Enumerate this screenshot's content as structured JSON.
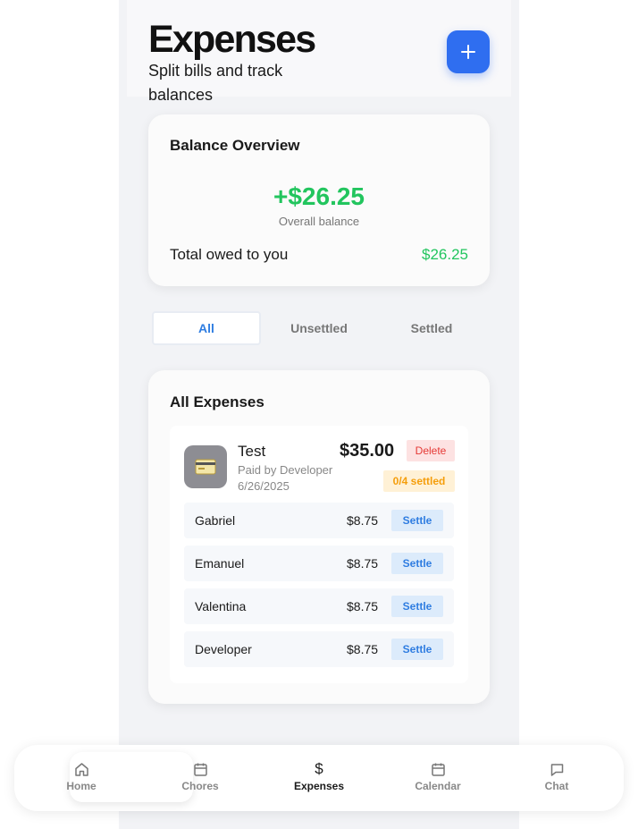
{
  "header": {
    "title": "Expenses",
    "subtitle": "Split bills and track balances"
  },
  "balance": {
    "title": "Balance Overview",
    "amount": "+$26.25",
    "caption": "Overall balance",
    "owed_label": "Total owed to you",
    "owed_value": "$26.25"
  },
  "filter_tabs": [
    {
      "label": "All",
      "active": true
    },
    {
      "label": "Unsettled",
      "active": false
    },
    {
      "label": "Settled",
      "active": false
    }
  ],
  "expenses_section": {
    "title": "All Expenses",
    "items": [
      {
        "name": "Test",
        "paid_by": "Paid by Developer",
        "date": "6/26/2025",
        "amount": "$35.00",
        "delete_label": "Delete",
        "settled_status": "0/4 settled",
        "icon": "credit-card-icon",
        "splits": [
          {
            "name": "Gabriel",
            "amount": "$8.75",
            "action": "Settle"
          },
          {
            "name": "Emanuel",
            "amount": "$8.75",
            "action": "Settle"
          },
          {
            "name": "Valentina",
            "amount": "$8.75",
            "action": "Settle"
          },
          {
            "name": "Developer",
            "amount": "$8.75",
            "action": "Settle"
          }
        ]
      }
    ]
  },
  "bottom_nav": [
    {
      "label": "Home",
      "icon": "home-icon"
    },
    {
      "label": "Chores",
      "icon": "calendar-icon"
    },
    {
      "label": "Expenses",
      "icon": "dollar-icon",
      "active": true
    },
    {
      "label": "Calendar",
      "icon": "calendar-icon"
    },
    {
      "label": "Chat",
      "icon": "chat-bubble-icon"
    }
  ],
  "colors": {
    "accent": "#2f6ef0",
    "positive": "#22c55e",
    "danger": "#e53935",
    "warning": "#f59e0b",
    "link": "#2f7de1"
  }
}
